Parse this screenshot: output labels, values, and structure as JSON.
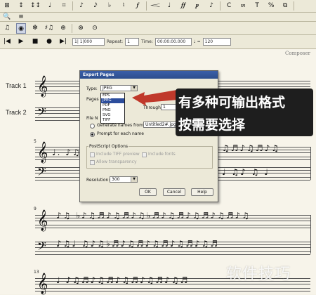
{
  "toolbar1": {
    "items": [
      "⊞",
      "↕",
      "↕↕",
      "♩",
      "⌗",
      "♪",
      "𝅘𝅥𝅯",
      "♭",
      "♮",
      "𝆑",
      "𝆒",
      "♩",
      "𝆑𝆑",
      "𝆏",
      "♪",
      "C",
      "𝆐",
      "T",
      "%",
      "⧉"
    ]
  },
  "toolbar2": {
    "items": [
      "🔍",
      "≡"
    ]
  },
  "toolbar3": {
    "items": [
      "♫",
      "◉",
      "✻",
      "♯♫",
      "⊕",
      "⊗",
      "⊙"
    ]
  },
  "playback": {
    "measure_value": "1| 1|000",
    "repeat_label": "Repeat:",
    "repeat_value": "1",
    "time_label": "Time:",
    "time_value": "00:00:00.000",
    "tempo_symbol": "♩ =",
    "tempo_value": "120"
  },
  "score": {
    "composer": "Composer",
    "track1": "Track 1",
    "track2": "Track 2",
    "measure_numbers": [
      "5",
      "9",
      "13"
    ]
  },
  "dialog": {
    "title": "Export Pages",
    "type_label": "Type:",
    "type_value": "JPEG",
    "pages_label": "Pages",
    "through_label": "Through:",
    "through_value": "1",
    "file_label": "File N",
    "generate_label": "Generate names from:",
    "generate_value": "Untitled2#.jpg",
    "prompt_label": "Prompt for each name",
    "postscript_label": "PostScript Options",
    "include_tiff": "Include TIFF preview",
    "include_fonts": "Include fonts",
    "allow_transparency": "Allow transparency",
    "resolution_label": "Resolution:",
    "resolution_value": "300",
    "ok": "OK",
    "cancel": "Cancel",
    "help": "Help",
    "options": [
      "EPS",
      "JPEG",
      "PDF",
      "PNG",
      "SVG",
      "TIFF"
    ],
    "selected_option": "JPEG"
  },
  "callout": {
    "line1": "有多种可输出格式",
    "line2": "按需要选择",
    "color": "#1e1e1e",
    "arrow_color": "#c0392b"
  },
  "watermark": "软件技巧"
}
